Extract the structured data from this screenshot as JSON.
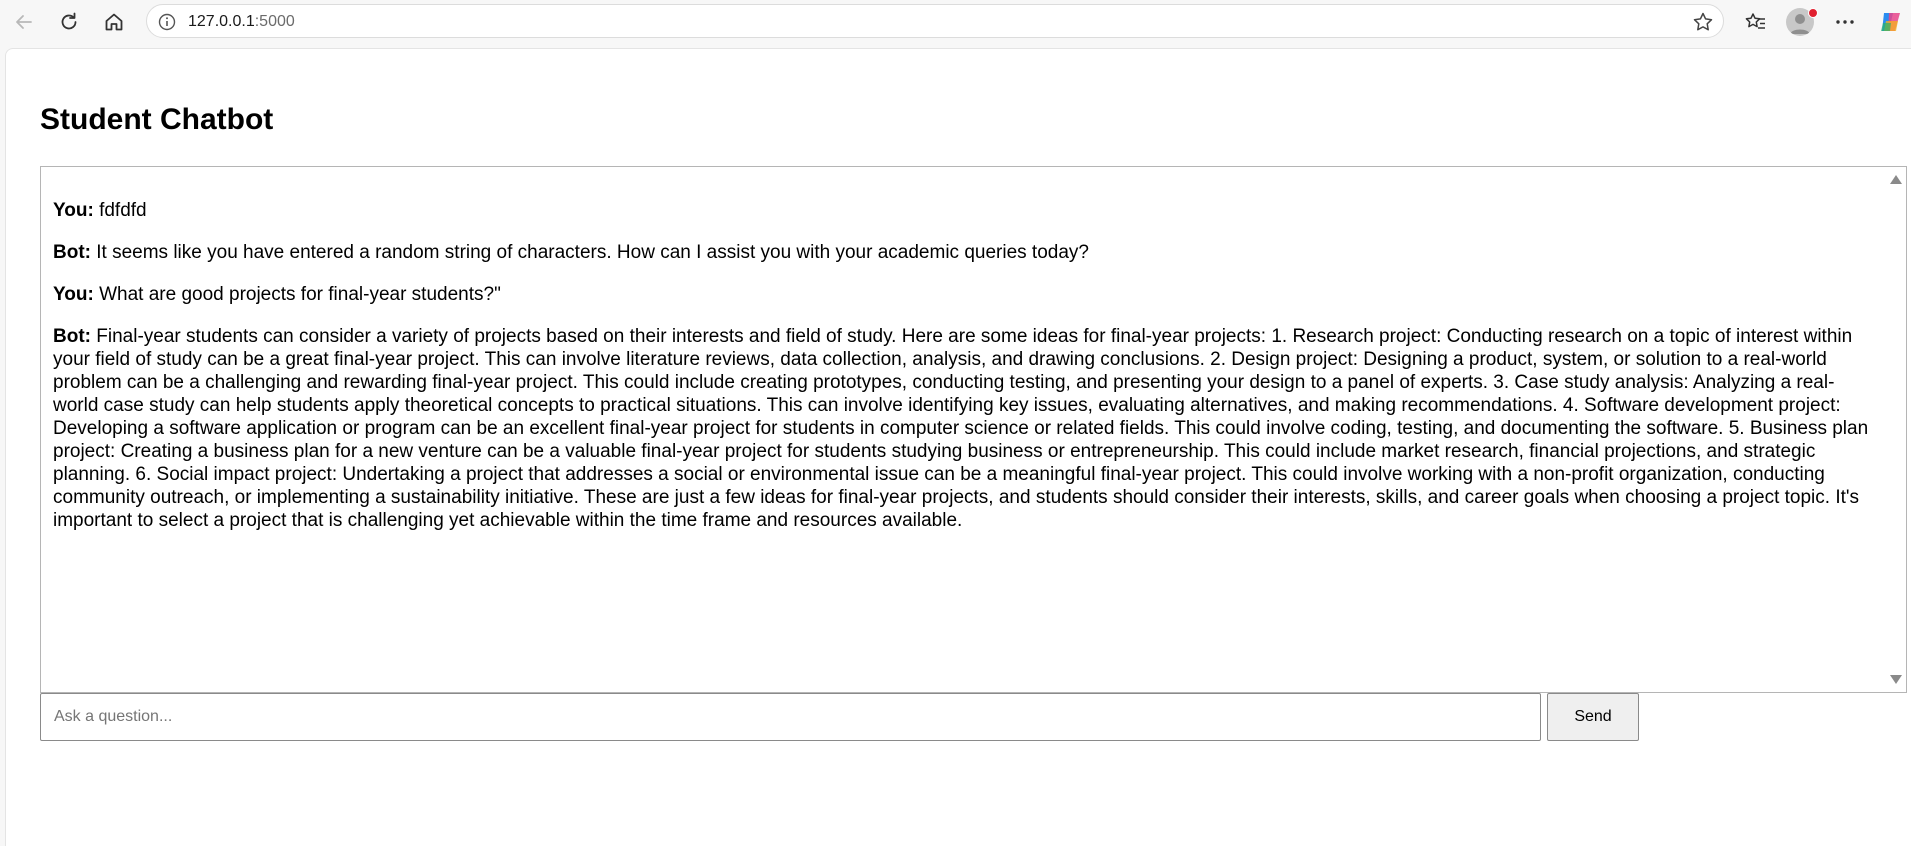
{
  "browser": {
    "url_host": "127.0.0.1",
    "url_port": ":5000"
  },
  "page": {
    "title": "Student Chatbot"
  },
  "chat": {
    "messages": [
      {
        "sender": "You:",
        "text": " fdfdfd"
      },
      {
        "sender": "Bot:",
        "text": " It seems like you have entered a random string of characters. How can I assist you with your academic queries today?"
      },
      {
        "sender": "You:",
        "text": " What are good projects for final-year students?\""
      },
      {
        "sender": "Bot:",
        "text": " Final-year students can consider a variety of projects based on their interests and field of study. Here are some ideas for final-year projects: 1. Research project: Conducting research on a topic of interest within your field of study can be a great final-year project. This can involve literature reviews, data collection, analysis, and drawing conclusions. 2. Design project: Designing a product, system, or solution to a real-world problem can be a challenging and rewarding final-year project. This could include creating prototypes, conducting testing, and presenting your design to a panel of experts. 3. Case study analysis: Analyzing a real-world case study can help students apply theoretical concepts to practical situations. This can involve identifying key issues, evaluating alternatives, and making recommendations. 4. Software development project: Developing a software application or program can be an excellent final-year project for students in computer science or related fields. This could involve coding, testing, and documenting the software. 5. Business plan project: Creating a business plan for a new venture can be a valuable final-year project for students studying business or entrepreneurship. This could include market research, financial projections, and strategic planning. 6. Social impact project: Undertaking a project that addresses a social or environmental issue can be a meaningful final-year project. This could involve working with a non-profit organization, conducting community outreach, or implementing a sustainability initiative. These are just a few ideas for final-year projects, and students should consider their interests, skills, and career goals when choosing a project topic. It's important to select a project that is challenging yet achievable within the time frame and resources available."
      }
    ]
  },
  "input": {
    "value": "",
    "placeholder": "Ask a question..."
  },
  "send_label": "Send",
  "icons": [
    "back-icon",
    "reload-icon",
    "home-icon",
    "info-icon",
    "star-icon",
    "favorites-icon",
    "profile-icon",
    "more-icon",
    "copilot-icon"
  ],
  "colors": {
    "notification_dot": "#e0202f"
  }
}
